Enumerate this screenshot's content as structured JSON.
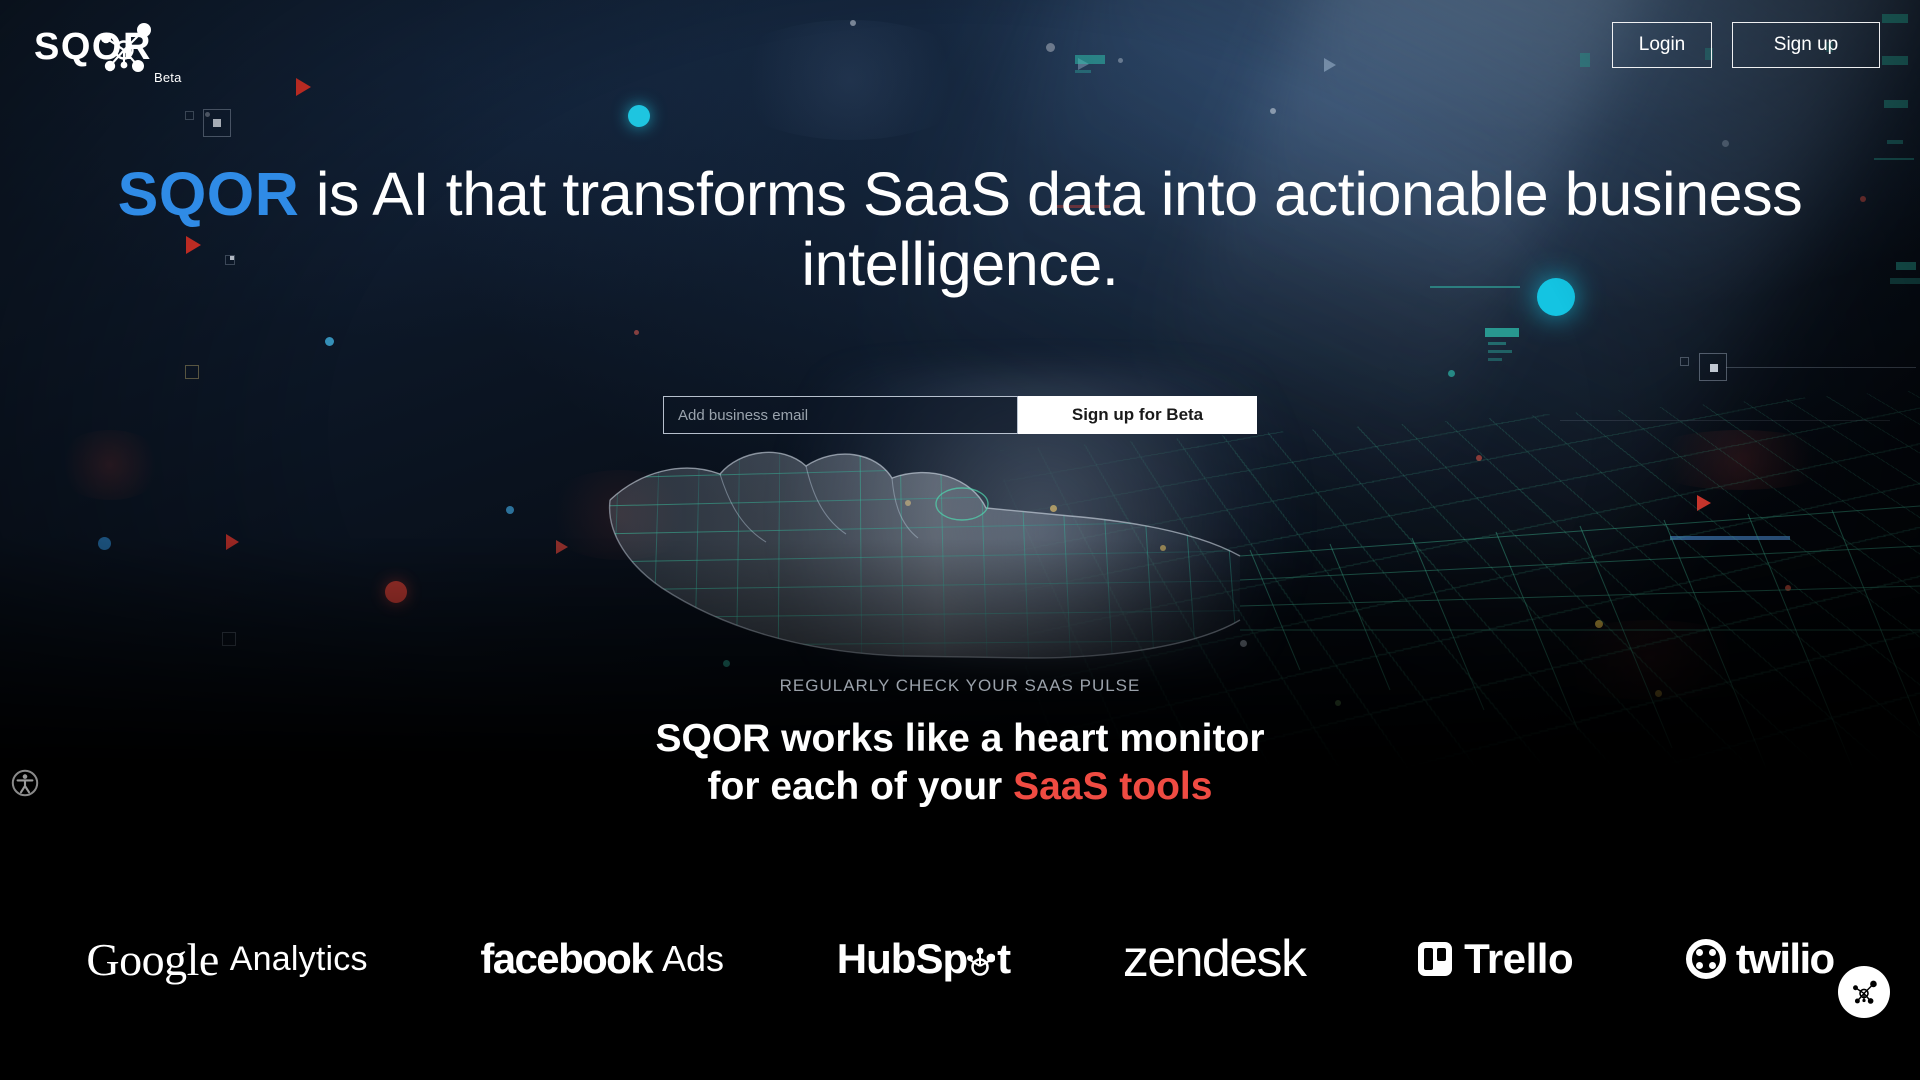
{
  "header": {
    "logo": {
      "text": "SQOR",
      "badge": "Beta",
      "icon": "network-node-icon"
    },
    "login_label": "Login",
    "signup_label": "Sign up"
  },
  "hero": {
    "headline_brand": "SQOR",
    "headline_rest": " is AI that transforms SaaS data into actionable business intelligence.",
    "headline_line1": "SQOR is AI that transforms SaaS data into",
    "headline_line2": "actionable business intelligence.",
    "email_placeholder": "Add business email",
    "email_value": "",
    "cta_label": "Sign up for Beta",
    "brand_color": "#2f8be6"
  },
  "pulse": {
    "eyebrow": "REGULARLY CHECK YOUR SAAS PULSE",
    "line1": "SQOR works like a heart monitor",
    "line2_prefix": "for each of your ",
    "line2_accent": "SaaS tools",
    "accent_color": "#ef4b42"
  },
  "logos": {
    "google": {
      "word1": "Google",
      "word2": "Analytics"
    },
    "facebook": {
      "word1": "facebook",
      "word2": "Ads"
    },
    "hubspot": {
      "word1": "HubSp",
      "word2": "t"
    },
    "zendesk": {
      "word1": "zendesk"
    },
    "trello": {
      "word1": "Trello",
      "icon": "trello-board-icon"
    },
    "twilio": {
      "word1": "twilio",
      "icon": "twilio-circle-dots-icon"
    }
  },
  "widgets": {
    "accessibility_icon": "accessibility-person-icon",
    "chat_icon": "sqor-network-icon"
  }
}
